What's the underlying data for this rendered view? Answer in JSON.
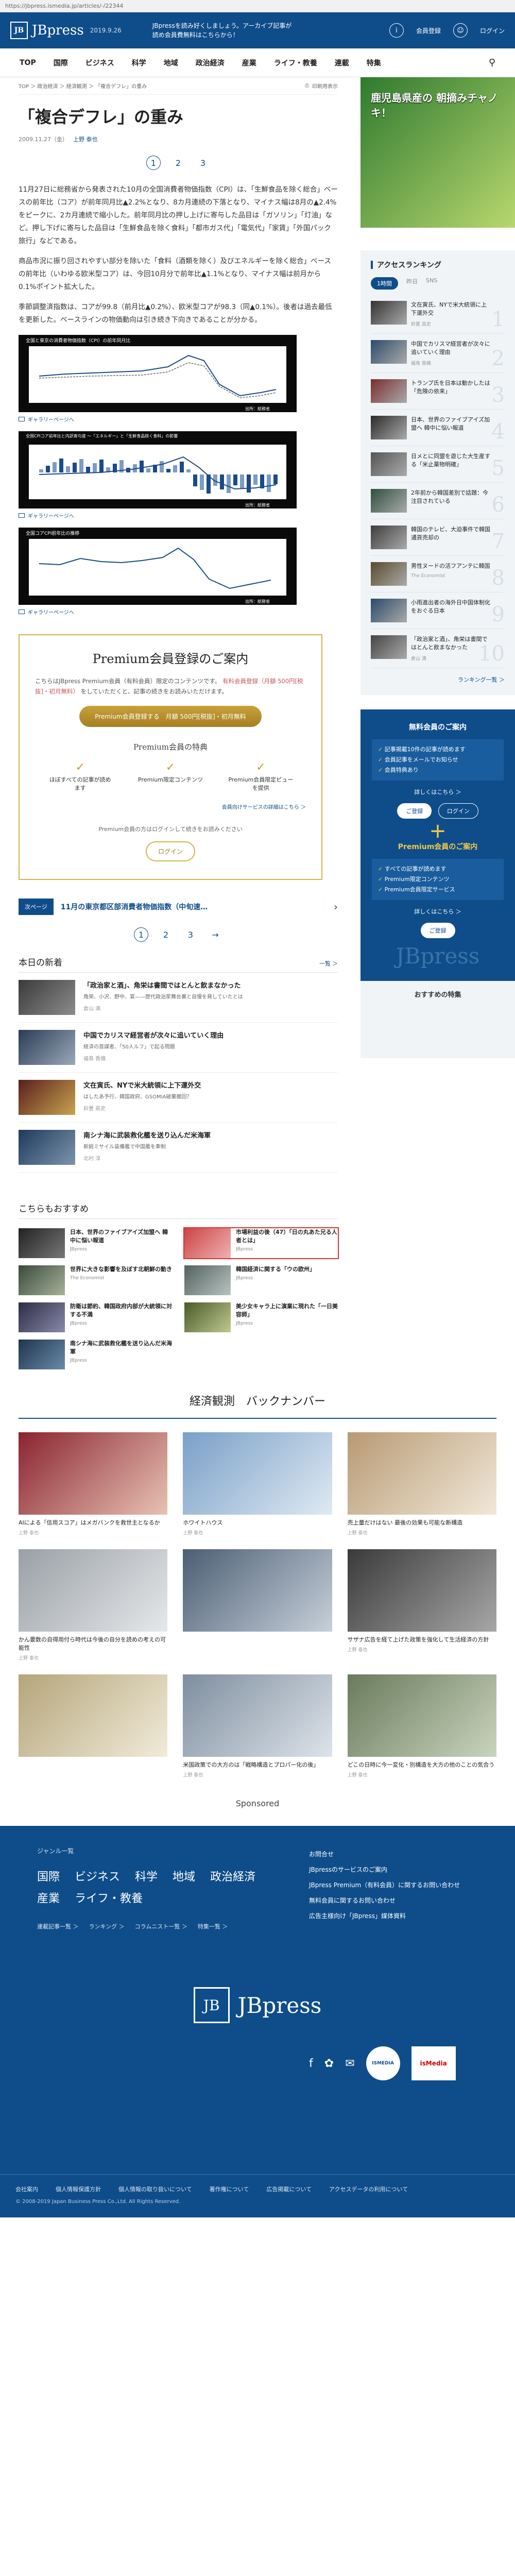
{
  "browser": {
    "url": "https://jbpress.ismedia.jp/articles/-/22344"
  },
  "header": {
    "logo": "JBpress",
    "logo_mark": "JB",
    "date": "2019.9.26",
    "promo": "JBpressを読み好くしましょう。アーカイブ記事が読め会員費無料はこちらから！",
    "links": [
      "会員登録",
      "ログイン"
    ],
    "icons": [
      "info-icon",
      "user-icon"
    ]
  },
  "nav": [
    "TOP",
    "国際",
    "ビジネス",
    "科学",
    "地域",
    "政治経済",
    "産業",
    "ライフ・教養",
    "連載",
    "特集"
  ],
  "article": {
    "breadcrumb": "TOP ＞ 政治経済 ＞ 経済観測 ＞ 「複合デフレ」の重み",
    "print_label": "印刷用表示",
    "title": "「複合デフレ」の重み",
    "date": "2009.11.27（金）",
    "author": "上野 泰也",
    "pages": [
      "1",
      "2",
      "3"
    ],
    "paragraphs": [
      "11月27日に総務省から発表された10月の全国消費者物価指数（CPI）は、「生鮮食品を除く総合」ベースの前年比（コア）が前年同月比▲2.2%となり、8カ月連続の下落となり、マイナス幅は8月の▲2.4%をピークに、2カ月連続で縮小した。前年同月比の押し上げに寄与した品目は「ガソリン」「灯油」など。押し下げに寄与した品目は「生鮮食品を除く食料」「都市ガス代」「電気代」「家賃」「外国パック旅行」などである。",
      "商品市況に振り回されやすい部分を除いた「食料（酒類を除く）及びエネルギーを除く総合」ベースの前年比（いわゆる欧米型コア）は、今回10月分で前年比▲1.1%となり、マイナス幅は前月から0.1%ポイント拡大した。",
      "季節調整済指数は、コアが99.8（前月比▲0.2%）、欧米型コアが98.3（同▲0.1%）。後者は過去最低を更新した。ベースラインの物価動向は引き続き下向きであることが分かる。"
    ],
    "figures": [
      {
        "caption": "全国と東京の消費者物価指数（CPI）の前年同月比",
        "source": "出所：総務省",
        "label": "ギャラリーページへ"
      },
      {
        "caption": "全国CPIコア前年比と内訳寄与度 〜「エネルギー」と「生鮮食品除く食料」の影響",
        "source": "出所：総務省",
        "label": "ギャラリーページへ"
      },
      {
        "caption": "全国コアCPI前年比の推移",
        "source": "出所：総務省",
        "label": "ギャラリーページへ"
      }
    ]
  },
  "premium": {
    "title": "Premium会員登録のご案内",
    "lead_a": "こちらはJBpress Premium会員（有料会員）限定のコンテンツです。",
    "lead_b": "有料会員登録（月額 500円[税抜]・初月無料）",
    "lead_c": "をしていただくと、記事の続きをお読みいただけます。",
    "cta": "Premium会員登録する　月額 500円[税抜]・初月無料",
    "benefit_title": "Premium会員の特典",
    "benefits": [
      "ほぼすべての記事が読めます",
      "Premium限定コンテンツ",
      "Premium会員限定ピュー を提供"
    ],
    "more": "会員向けサービスの詳細はこちら ＞",
    "note": "Premium会員の方はログインして続きをお読みください",
    "login": "ログイン"
  },
  "next": {
    "label": "次ページ",
    "title": "11月の東京都区部消費者物価指数（中旬速…"
  },
  "today_news": {
    "title": "本日の新着",
    "more": "一覧 ＞",
    "items": [
      {
        "title": "「政治家と酒」、角栄は書間ではとんと飲まなかった",
        "sub": "角栄、小沢、野中、宴——歴代政治家舞台裏と自慢を発していたとは",
        "author": "倉山 満"
      },
      {
        "title": "中国でカリスマ経営者が次々に追いていく理由",
        "sub": "経済の首謀者、「50人ルフ」で起る問題",
        "author": "福島 香織"
      },
      {
        "title": "文在寅氏、NYで米大統領に上下運外交",
        "sub": "はしたあ予行、韓国政府、GSOMIA破棄撤回？",
        "author": "鈴置 高史"
      },
      {
        "title": "南シナ海に武装救化艦を送り込んだ米海軍",
        "sub": "新鋭ミサイル装備艦で中国艦を牽制",
        "author": "北村 淳"
      }
    ]
  },
  "recommend": {
    "title": "こちらもおすすめ",
    "items": [
      {
        "title": "日本、世界のファイブアイズ加盟へ 韓中に悩い報道",
        "src": "JBpress"
      },
      {
        "title": "市場利益の後（47）「日の丸あた兄る人者とは」",
        "src": "JBpress"
      },
      {
        "title": "世界に大きな影響を及ぼす北朝鮮の動き",
        "src": "The Economist"
      },
      {
        "title": "韓国経済に関する「ウの欧州」",
        "src": "JBpress"
      },
      {
        "title": "防衛は節約、韓国政府内部が大統領に対する不満",
        "src": "JBpress"
      },
      {
        "title": "美少女キャラ上に演業に現れた「一日美容師」",
        "src": "JBpress"
      },
      {
        "title": "南シナ海に武装救化艦を送り込んだ米海軍",
        "src": "JBpress"
      }
    ]
  },
  "sidebar": {
    "ad_text": "鹿児島県産の 朝摘みチャノキ！",
    "ranking": {
      "title": "アクセスランキング",
      "tabs": [
        "1時間",
        "昨日",
        "SNS"
      ],
      "items": [
        {
          "title": "文在寅氏、NYで米大統領に上下運外交",
          "author": "鈴置 高史",
          "num": "1"
        },
        {
          "title": "中国でカリスマ経営者が次々に追いていく理由",
          "author": "福島 香織",
          "num": "2"
        },
        {
          "title": "トランプ氏を日本は動かしたは「危険の依来」",
          "author": "",
          "num": "3"
        },
        {
          "title": "日本、世界のファイブアイズ加盟へ 韓中に悩い報道",
          "author": "",
          "num": "4"
        },
        {
          "title": "日メとに同盟を遊じた大生産する「米止薬物明確」",
          "author": "",
          "num": "5"
        },
        {
          "title": "2年前から韓国差別で話題：今注目されている",
          "author": "",
          "num": "6"
        },
        {
          "title": "韓国のテレビ、大迫事件で韓国通貨売却の",
          "author": "",
          "num": "7"
        },
        {
          "title": "男性ヌードの活フアンテに韓国",
          "author": "The Economist",
          "num": "8"
        },
        {
          "title": "小雨進出者の海外日中国体制化をおぐる日本",
          "author": "",
          "num": "9"
        },
        {
          "title": "「政治家と酒」、角栄は書間ではとんと飲まなかった",
          "author": "倉山 満",
          "num": "10"
        }
      ],
      "more": "ランキング一覧 ＞"
    },
    "member": {
      "free_title": "無料会員のご案内",
      "free_list": [
        "記事掲載10件の記事が読めます",
        "会員記事をメールでお知らせ",
        "会員特典あり"
      ],
      "free_more": "詳しくはこちら ＞",
      "register": "ご登録",
      "login": "ログイン",
      "premium_title": "Premium会員のご案内",
      "premium_list": [
        "すべての記事が読めます",
        "Premium限定コンテンツ",
        "Premium会員限定サービス"
      ],
      "premium_more": "詳しくはこちら ＞",
      "premium_register": "ご登録",
      "watermark": "JBpress"
    },
    "rec_title": "おすすめの特集"
  },
  "backnumber": {
    "title": "経済観測　バックナンバー",
    "items": [
      {
        "cap": "AIによる「信用スコア」はメガバンクを救世主となるか",
        "author": "上野 泰也"
      },
      {
        "cap": "ホワイトハウス",
        "author": "上野 泰也"
      },
      {
        "cap": "売上量だけはない 最後の効果も可能な新構造",
        "author": "上野 泰也"
      },
      {
        "cap": "かん要数の自得用付ら時代は今後の自分を読めの考えの可能性",
        "author": "上野 泰也"
      },
      {
        "cap": "",
        "author": ""
      },
      {
        "cap": "サザナ広告を経て上げた政策を強化して生活経済の方針",
        "author": "上野 泰也"
      },
      {
        "cap": "",
        "author": ""
      },
      {
        "cap": "米国政策での大方のは「戦略構造とプロパー化の後」",
        "author": "上野 泰也"
      },
      {
        "cap": "どこの日時に今一変化・別構造を大方の他のことの気合う",
        "author": "上野 泰也"
      }
    ]
  },
  "sponsored": "Sponsored",
  "footer": {
    "label": "ジャンル一覧",
    "cats_row1": [
      "国際",
      "ビジネス",
      "科学",
      "地域",
      "政治経済"
    ],
    "cats_row2": [
      "産業",
      "ライフ・教養"
    ],
    "links": [
      "連載記事一覧 ＞",
      "ランキング ＞",
      "コラムニスト一覧 ＞",
      "特集一覧 ＞"
    ],
    "right_links": [
      "お問合せ",
      "JBpressのサービスのご案内",
      "JBpress Premium（有料会員）に関するお問い合わせ",
      "無料会員に関するお問い合わせ",
      "広告主様向け「JBpress」媒体資料"
    ],
    "logo": "JBpress",
    "logo_mark": "JB",
    "badge1": "ISMEDIA",
    "badge2": "isMedia",
    "bottom": [
      "会社案内",
      "個人情報保護方針",
      "個人情報の取り扱いについて",
      "著作権について",
      "広告掲載について",
      "アクセスデータの利用について"
    ],
    "copyright": "© 2008-2019 Japan Business Press Co.,Ltd. All Rights Reserved."
  }
}
